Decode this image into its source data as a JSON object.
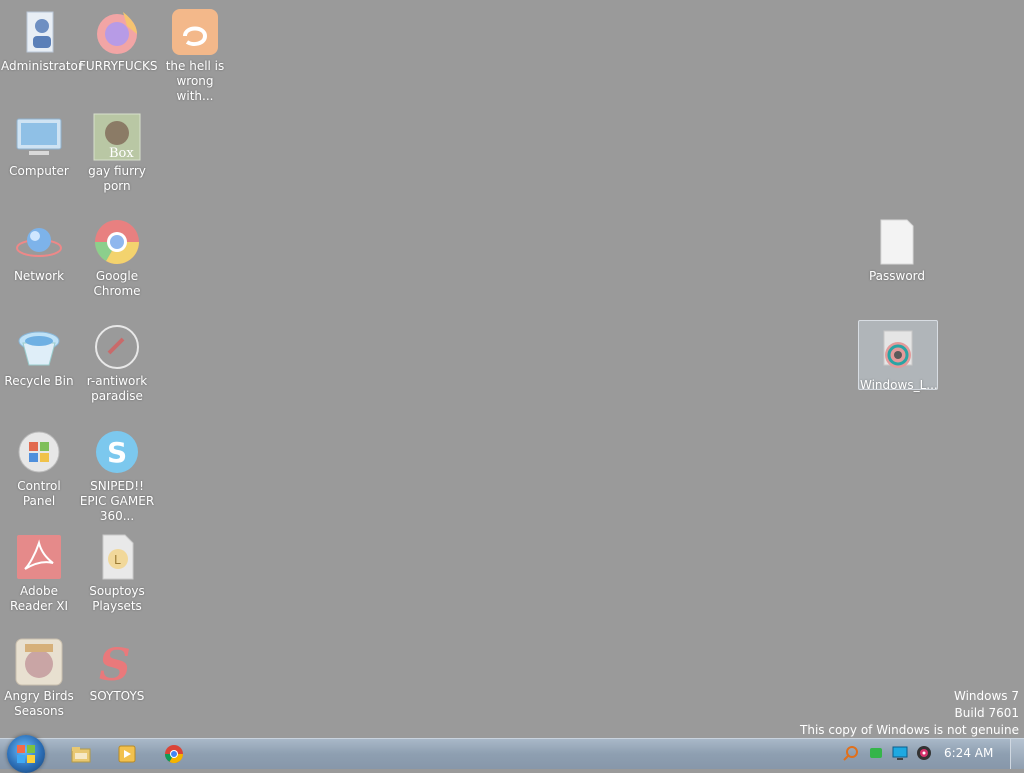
{
  "desktop_icons": [
    {
      "label": "Administrator"
    },
    {
      "label": "FURRYFUCKS"
    },
    {
      "label": "the hell is wrong with..."
    },
    {
      "label": "Computer"
    },
    {
      "label": "gay fiurry porn"
    },
    {
      "label": "Network"
    },
    {
      "label": "Google Chrome"
    },
    {
      "label": "Recycle Bin"
    },
    {
      "label": "r-antiwork paradise"
    },
    {
      "label": "Control Panel"
    },
    {
      "label": "SNIPED!! EPIC GAMER 360..."
    },
    {
      "label": "Adobe Reader XI"
    },
    {
      "label": "Souptoys Playsets"
    },
    {
      "label": "Angry Birds Seasons"
    },
    {
      "label": "SOYTOYS"
    },
    {
      "label": "Password"
    },
    {
      "label": "Windows_L..."
    }
  ],
  "watermark": {
    "line1": "Windows 7",
    "line2": "Build 7601",
    "line3": "This copy of Windows is not genuine"
  },
  "taskbar": {
    "clock": "6:24 AM",
    "pinned": [
      "explorer-icon",
      "media-player-icon",
      "chrome-icon"
    ],
    "tray": [
      "search-tray-icon",
      "green-tray-icon",
      "monitor-tray-icon",
      "speaker-tray-icon"
    ]
  }
}
